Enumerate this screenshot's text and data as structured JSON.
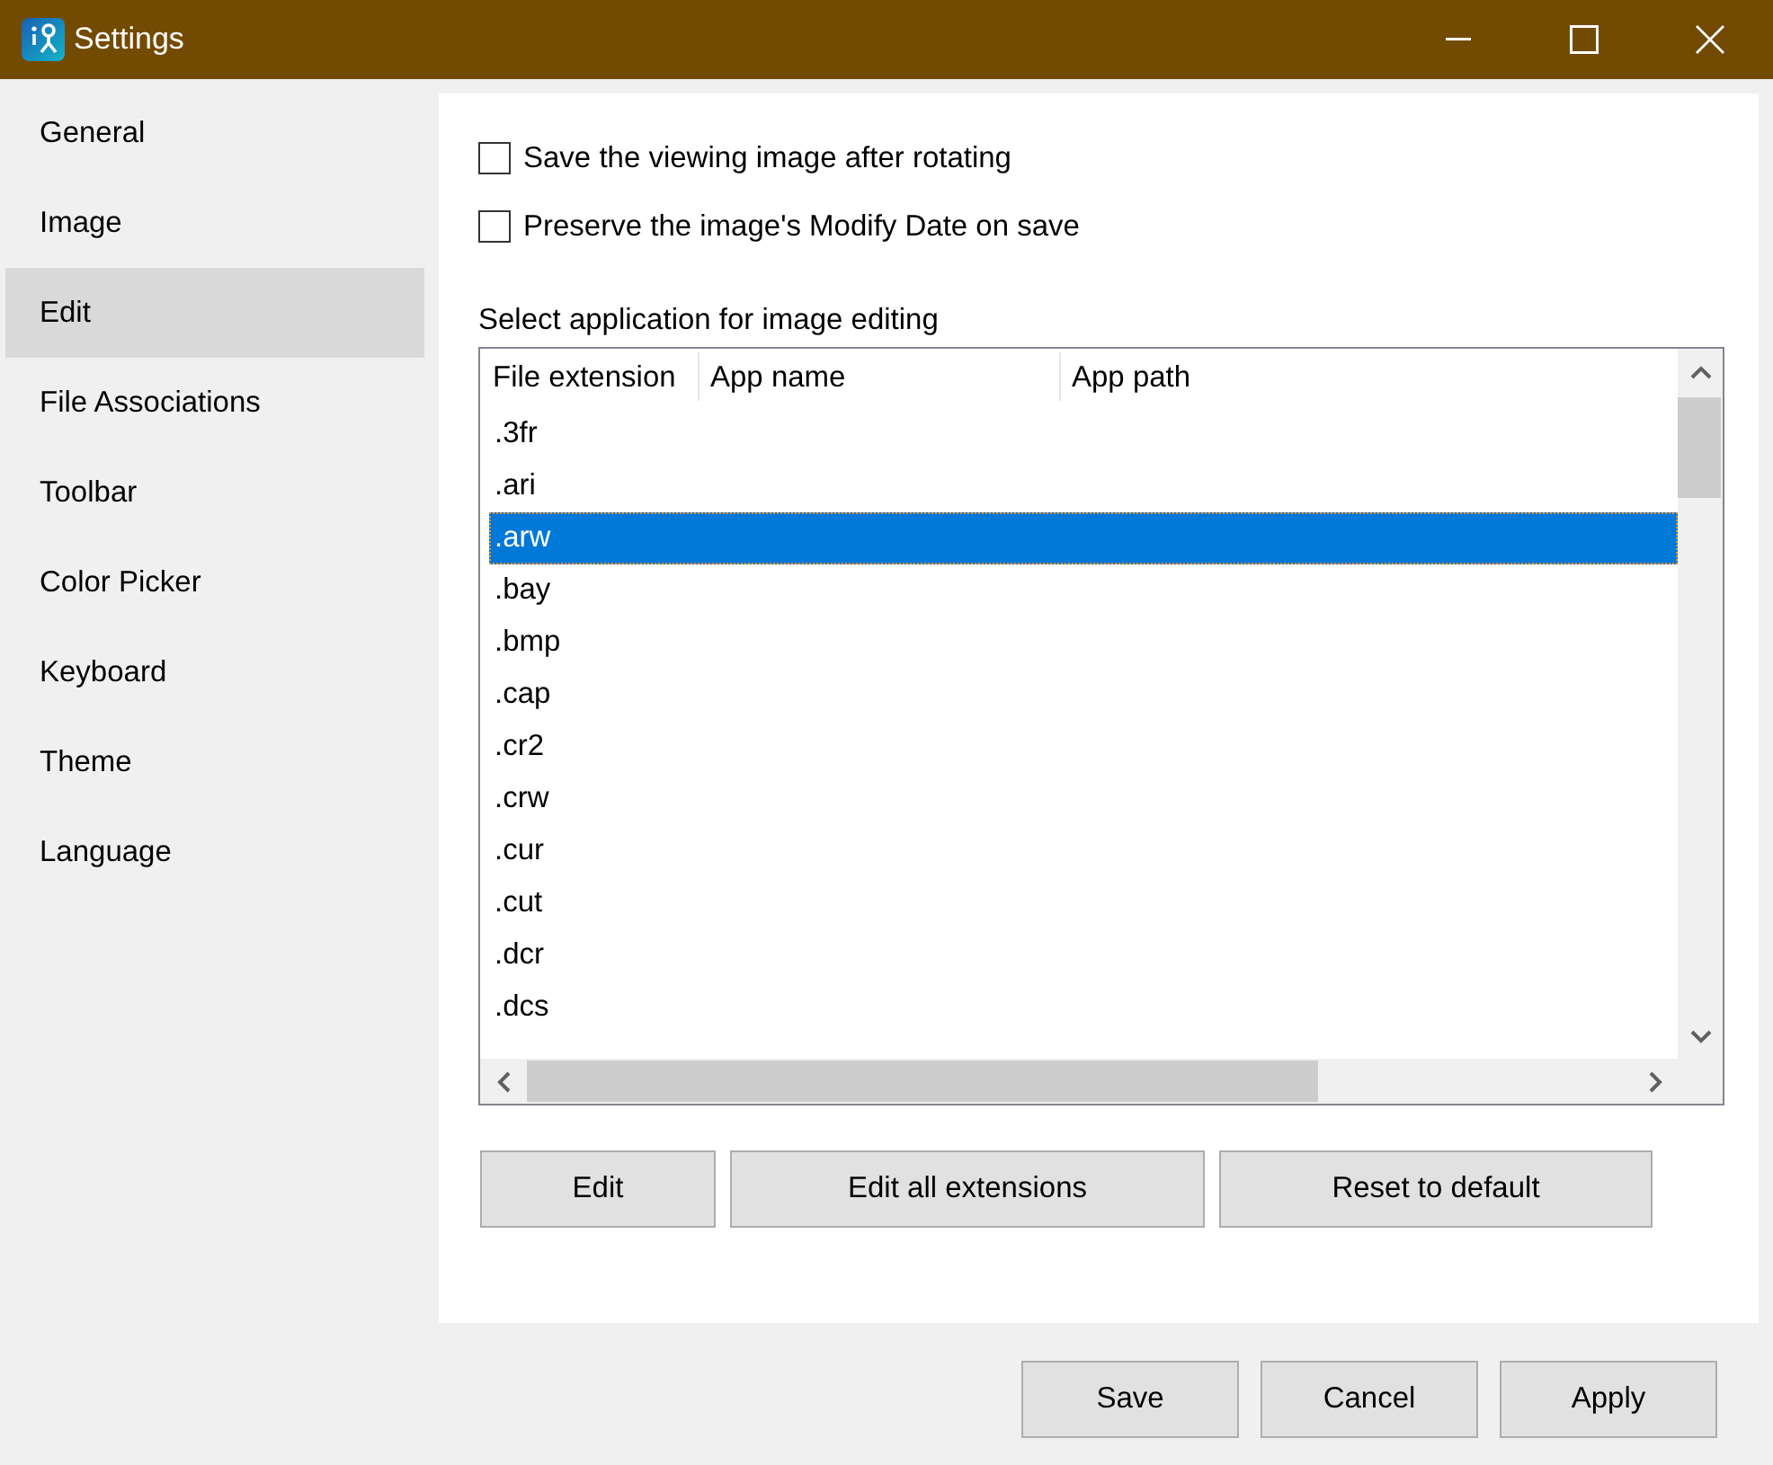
{
  "window": {
    "title": "Settings"
  },
  "sidebar": {
    "items": [
      {
        "label": "General",
        "selected": false
      },
      {
        "label": "Image",
        "selected": false
      },
      {
        "label": "Edit",
        "selected": true
      },
      {
        "label": "File Associations",
        "selected": false
      },
      {
        "label": "Toolbar",
        "selected": false
      },
      {
        "label": "Color Picker",
        "selected": false
      },
      {
        "label": "Keyboard",
        "selected": false
      },
      {
        "label": "Theme",
        "selected": false
      },
      {
        "label": "Language",
        "selected": false
      }
    ]
  },
  "edit_page": {
    "checkboxes": [
      {
        "label": "Save the viewing image after rotating",
        "checked": false
      },
      {
        "label": "Preserve the image's Modify Date on save",
        "checked": false
      }
    ],
    "editor_table": {
      "label": "Select application for image editing",
      "columns": [
        "File extension",
        "App name",
        "App path"
      ],
      "rows": [
        {
          "extension": ".3fr",
          "selected": false
        },
        {
          "extension": ".ari",
          "selected": false
        },
        {
          "extension": ".arw",
          "selected": true
        },
        {
          "extension": ".bay",
          "selected": false
        },
        {
          "extension": ".bmp",
          "selected": false
        },
        {
          "extension": ".cap",
          "selected": false
        },
        {
          "extension": ".cr2",
          "selected": false
        },
        {
          "extension": ".crw",
          "selected": false
        },
        {
          "extension": ".cur",
          "selected": false
        },
        {
          "extension": ".cut",
          "selected": false
        },
        {
          "extension": ".dcr",
          "selected": false
        },
        {
          "extension": ".dcs",
          "selected": false
        }
      ]
    },
    "buttons": [
      "Edit",
      "Edit all extensions",
      "Reset to default"
    ]
  },
  "footer_buttons": [
    "Save",
    "Cancel",
    "Apply"
  ]
}
